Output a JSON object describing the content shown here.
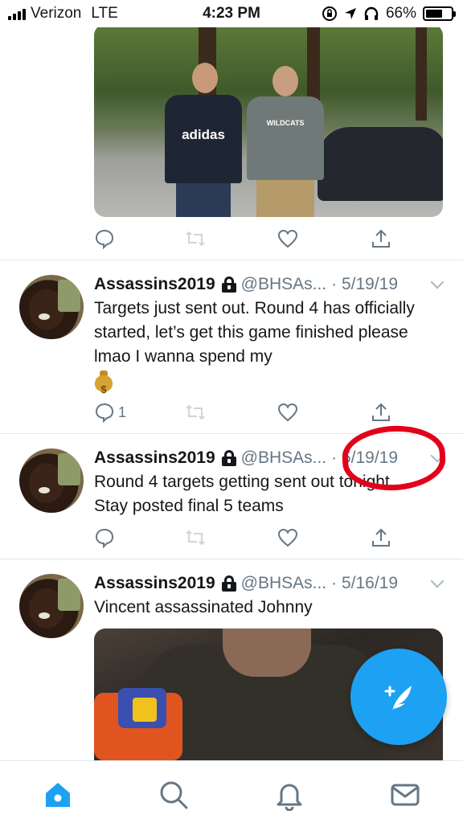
{
  "status_bar": {
    "carrier": "Verizon",
    "network": "LTE",
    "time": "4:23 PM",
    "battery": "66%",
    "battery_level": 0.66,
    "icons": [
      "signal-icon",
      "screen-rotation-lock-icon",
      "location-arrow-icon",
      "headphones-icon",
      "battery-icon"
    ]
  },
  "tweets": [
    {
      "name": "Assassins2019",
      "handle": "@BHSAs...",
      "date": "· 5/19/19",
      "text": "Targets just sent out. Round 4 has officially started, let’s get this game finished please lmao I wanna spend my",
      "emoji": "money-bag",
      "reply_count": "1"
    },
    {
      "name": "Assassins2019",
      "handle": "@BHSAs...",
      "date": "· 5/19/19",
      "text_line1": "Round 4 targets getting sent out tonight.",
      "text_line2": "Stay posted final 5 teams"
    },
    {
      "name": "Assassins2019",
      "handle": "@BHSAs...",
      "date": "· 5/16/19",
      "text": "Vincent assassinated Johnny"
    }
  ],
  "photo1": {
    "shirt_text": "adidas",
    "shirt2_text": "WILDCATS"
  },
  "annotation": {
    "color": "#e3001b"
  },
  "colors": {
    "accent": "#1da1f2",
    "muted": "#657786",
    "text": "#14171a"
  },
  "tab_bar": [
    "home-icon",
    "search-icon",
    "notifications-icon",
    "messages-icon"
  ]
}
